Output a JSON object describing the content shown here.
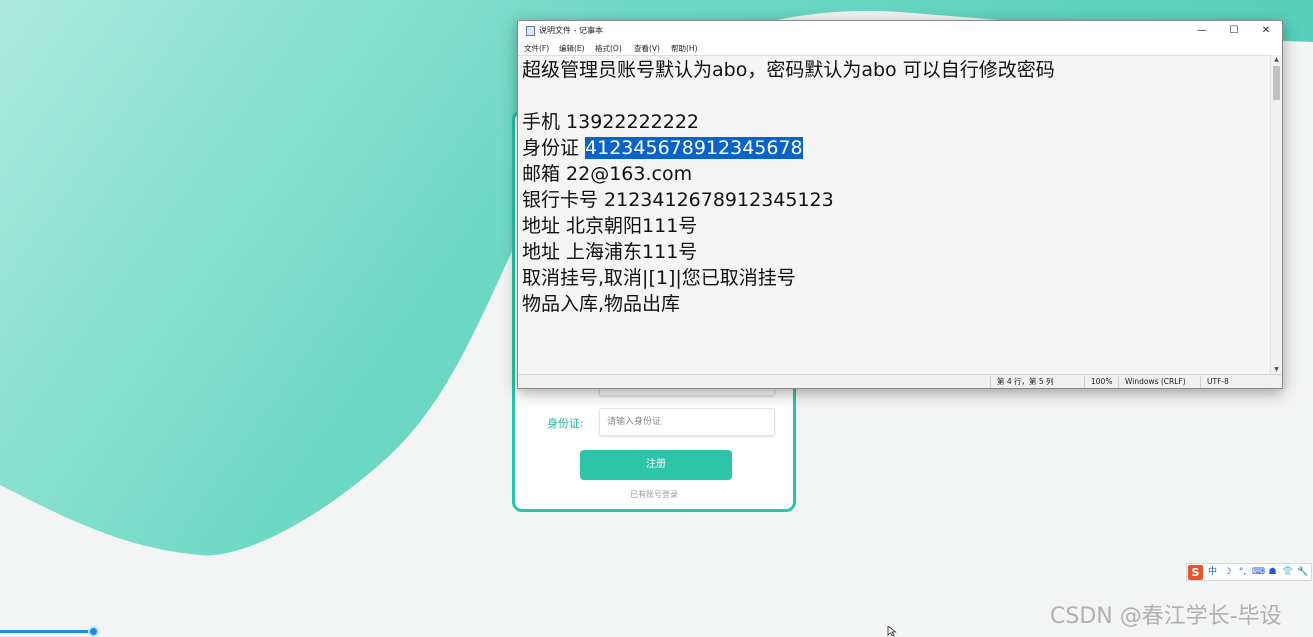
{
  "notepad": {
    "title": "说明文件 - 记事本",
    "window_buttons": {
      "minimize": "—",
      "maximize": "☐",
      "close": "✕"
    },
    "menu": [
      "文件(F)",
      "编辑(E)",
      "格式(O)",
      "查看(V)",
      "帮助(H)"
    ],
    "lines": [
      "超级管理员账号默认为abo，密码默认为abo 可以自行修改密码",
      "",
      "手机 13922222222",
      {
        "prefix": "身份证 ",
        "selected": "412345678912345678"
      },
      "邮箱 22@163.com",
      "银行卡号 2123412678912345123",
      "地址 北京朝阳111号",
      "地址 上海浦东111号",
      "取消挂号,取消|[1]|您已取消挂号",
      "物品入库,物品出库"
    ],
    "status": {
      "position": "第 4 行，第 5 列",
      "zoom": "100%",
      "line_ending": "Windows (CRLF)",
      "encoding": "UTF-8"
    }
  },
  "register_form": {
    "id_label": "身份证:",
    "id_placeholder": "请输入身份证",
    "submit_label": "注册",
    "login_link": "已有账号登录"
  },
  "ime": {
    "logo": "S",
    "items": [
      "中",
      "☽",
      "°,",
      "⌨",
      "☗",
      "👕",
      "🔧"
    ]
  },
  "watermark": "CSDN @春江学长-毕设",
  "colors": {
    "accent": "#2ec4a9",
    "selection": "#0a64c8",
    "ime_logo": "#e8542b",
    "progress": "#1e88e5"
  },
  "playback_progress": 0.07
}
